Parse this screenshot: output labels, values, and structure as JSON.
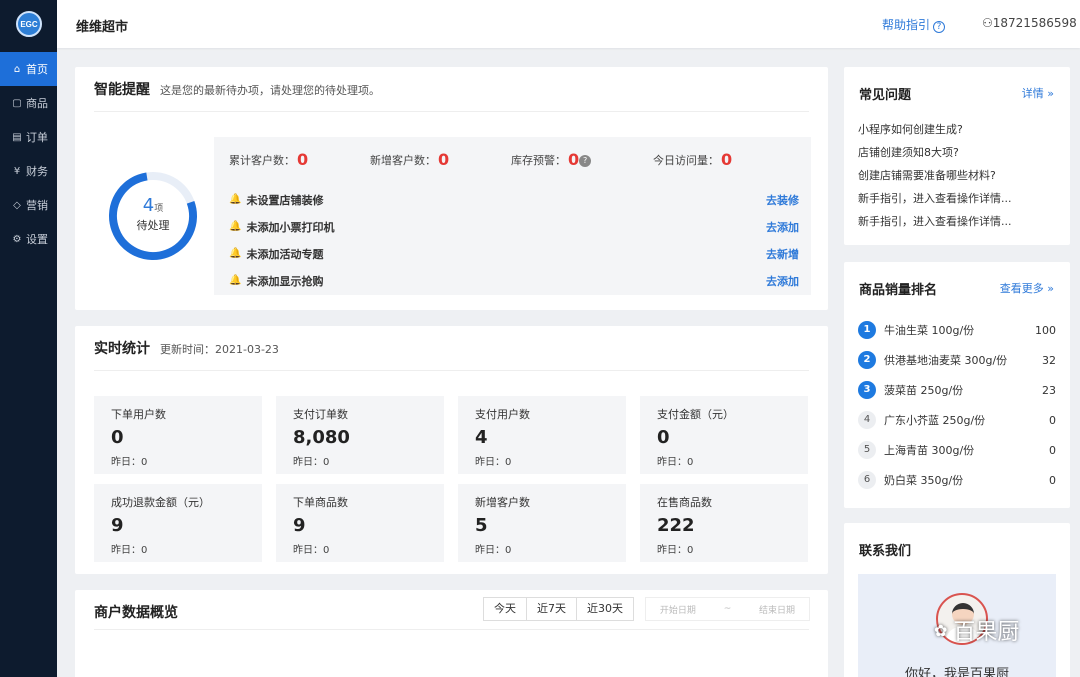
{
  "sidebar": {
    "logo": "EGC",
    "items": [
      {
        "icon": "home-icon",
        "glyph": "⌂",
        "label": "首页"
      },
      {
        "icon": "bag-icon",
        "glyph": "▢",
        "label": "商品"
      },
      {
        "icon": "order-icon",
        "glyph": "▤",
        "label": "订单"
      },
      {
        "icon": "finance-icon",
        "glyph": "¥",
        "label": "财务"
      },
      {
        "icon": "tag-icon",
        "glyph": "◇",
        "label": "营销"
      },
      {
        "icon": "settings-icon",
        "glyph": "⚙",
        "label": "设置"
      }
    ]
  },
  "header": {
    "store_name": "维维超市",
    "help": "帮助指引",
    "help_glyph": "?",
    "user_glyph": "⚇",
    "user": "18721586598"
  },
  "reminder": {
    "title": "智能提醒",
    "subtitle": "这是您的最新待办项，请处理您的待处理项。",
    "pending_count": "4",
    "pending_unit": "项",
    "pending_label": "待处理",
    "pending_fraction": 0.78,
    "stats": [
      {
        "label": "累计客户数：",
        "value": "0"
      },
      {
        "label": "新增客户数：",
        "value": "0"
      },
      {
        "label": "库存预警：",
        "value": "0",
        "help": "?"
      },
      {
        "label": "今日访问量：",
        "value": "0"
      }
    ],
    "todos": [
      {
        "text": "未设置店铺装修",
        "action": "去装修"
      },
      {
        "text": "未添加小票打印机",
        "action": "去添加"
      },
      {
        "text": "未添加活动专题",
        "action": "去新增"
      },
      {
        "text": "未添加显示抢购",
        "action": "去添加"
      }
    ],
    "bell_glyph": "🔔"
  },
  "realtime": {
    "title": "实时统计",
    "updated": "更新时间：2021-03-23",
    "metrics": [
      {
        "label": "下单用户数",
        "value": "0",
        "yesterday": "昨日：0"
      },
      {
        "label": "支付订单数",
        "value": "8,080",
        "yesterday": "昨日：0"
      },
      {
        "label": "支付用户数",
        "value": "4",
        "yesterday": "昨日：0"
      },
      {
        "label": "支付金额（元）",
        "value": "0",
        "yesterday": "昨日：0"
      },
      {
        "label": "成功退款金额（元）",
        "value": "9",
        "yesterday": "昨日：0"
      },
      {
        "label": "下单商品数",
        "value": "9",
        "yesterday": "昨日：0"
      },
      {
        "label": "新增客户数",
        "value": "5",
        "yesterday": "昨日：0"
      },
      {
        "label": "在售商品数",
        "value": "222",
        "yesterday": "昨日：0"
      }
    ]
  },
  "overview": {
    "title": "商户数据概览",
    "ranges": [
      "今天",
      "近7天",
      "近30天"
    ],
    "start_date": "开始日期",
    "date_sep": "~",
    "end_date": "结束日期"
  },
  "faq": {
    "title": "常见问题",
    "more": "详情 »",
    "items": [
      "小程序如何创建生成?",
      "店铺创建须知8大项?",
      "创建店铺需要准备哪些材料?",
      "新手指引，进入查看操作详情...",
      "新手指引，进入查看操作详情..."
    ]
  },
  "ranking": {
    "title": "商品销量排名",
    "more": "查看更多 »",
    "items": [
      {
        "rank": "1",
        "name": "牛油生菜 100g/份",
        "sales": "100"
      },
      {
        "rank": "2",
        "name": "供港基地油麦菜 300g/份",
        "sales": "32"
      },
      {
        "rank": "3",
        "name": "菠菜苗 250g/份",
        "sales": "23"
      },
      {
        "rank": "4",
        "name": "广东小芥蓝 250g/份",
        "sales": "0"
      },
      {
        "rank": "5",
        "name": "上海青苗 300g/份",
        "sales": "0"
      },
      {
        "rank": "6",
        "name": "奶白菜 350g/份",
        "sales": "0"
      }
    ]
  },
  "contact": {
    "title": "联系我们",
    "greeting": "你好，我是百果厨"
  },
  "watermark": {
    "glyph": "✿",
    "text": "百果厨"
  },
  "colors": {
    "primary": "#1e6fd9",
    "sidebar": "#0d1b2e",
    "alert": "#e53935",
    "link": "#2f7ad9"
  }
}
